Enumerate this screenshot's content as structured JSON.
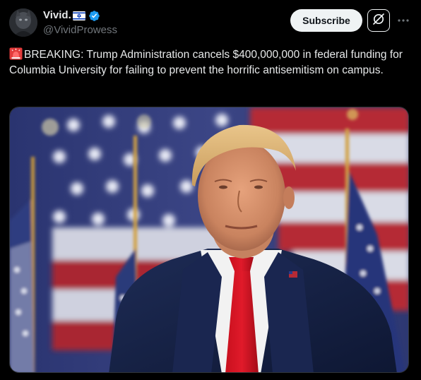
{
  "author": {
    "display_name": "Vivid.",
    "handle": "@VividProwess",
    "flag_icon": "israel-flag-icon",
    "verified_icon": "verified-badge-icon",
    "verified_color": "#1d9bf0"
  },
  "actions": {
    "subscribe_label": "Subscribe",
    "grok_icon": "grok-icon",
    "more_icon": "more-icon"
  },
  "post": {
    "siren_icon": "police-light-icon",
    "text": "BREAKING: Trump Administration cancels $400,000,000 in federal funding for Columbia University for failing to prevent the horrific antisemitism on campus."
  },
  "media": {
    "type": "photo"
  },
  "colors": {
    "background": "#000000",
    "text": "#e7e9ea",
    "secondary_text": "#71767b",
    "button_bg": "#eff3f4"
  }
}
